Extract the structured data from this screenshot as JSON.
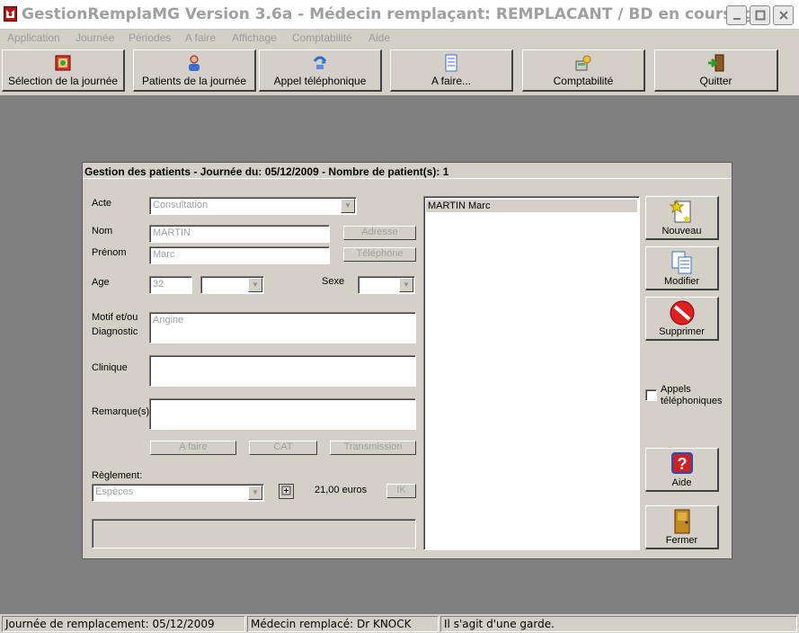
{
  "window": {
    "title": "GestionRemplaMG Version 3.6a - Médecin remplaçant: REMPLACANT / BD en cours: g...",
    "minimize_icon": "minimize-icon",
    "maximize_icon": "maximize-icon",
    "close_icon": "close-icon"
  },
  "menu": {
    "items": [
      {
        "label": "Application"
      },
      {
        "label": "Journée"
      },
      {
        "label": "Périodes"
      },
      {
        "label": "A faire"
      },
      {
        "label": "Affichage"
      },
      {
        "label": "Comptabilité"
      },
      {
        "label": "Aide"
      }
    ]
  },
  "toolbar": {
    "buttons": [
      {
        "label": "Sélection de la journée",
        "icon": "calendar-icon"
      },
      {
        "label": "Patients de la journée",
        "icon": "person-icon"
      },
      {
        "label": "Appel téléphonique",
        "icon": "phone-arrow-icon"
      },
      {
        "label": "A faire...",
        "icon": "list-icon"
      },
      {
        "label": "Comptabilité",
        "icon": "accounting-icon"
      },
      {
        "label": "Quitter",
        "icon": "exit-door-icon"
      }
    ]
  },
  "panel": {
    "title": "Gestion des patients - Journée du: 05/12/2009 - Nombre de patient(s): 1",
    "labels": {
      "acte": "Acte",
      "nom": "Nom",
      "prenom": "Prénom",
      "age": "Age",
      "sexe": "Sexe",
      "motif_line1": "Motif et/ou",
      "motif_line2": "Diagnostic",
      "clinique": "Clinique",
      "remarques": "Remarque(s)",
      "reglement": "Règlement:"
    },
    "values": {
      "acte": "Consultation",
      "nom": "MARTIN",
      "prenom": "Marc",
      "age": "32",
      "age_unit": "",
      "sexe": "",
      "motif": "Angine",
      "clinique": "",
      "remarques": "",
      "reglement": "Espèces",
      "amount": "21,00 euros",
      "notes": ""
    },
    "buttons": {
      "adresse": "Adresse",
      "telephone": "Téléphone",
      "a_faire": "A faire",
      "cat": "CAT",
      "transmission": "Transmission",
      "ik": "IK"
    },
    "patients": [
      "MARTIN Marc"
    ],
    "side_buttons": {
      "nouveau": "Nouveau",
      "modifier": "Modifier",
      "supprimer": "Supprimer",
      "aide": "Aide",
      "fermer": "Fermer"
    },
    "appels_line1": "Appels",
    "appels_line2": "téléphoniques",
    "appels_checked": false
  },
  "status": {
    "journee": "Journée de remplacement: 05/12/2009",
    "medecin": "Médecin remplacé: Dr KNOCK",
    "garde": "Il s'agit d'une garde."
  }
}
